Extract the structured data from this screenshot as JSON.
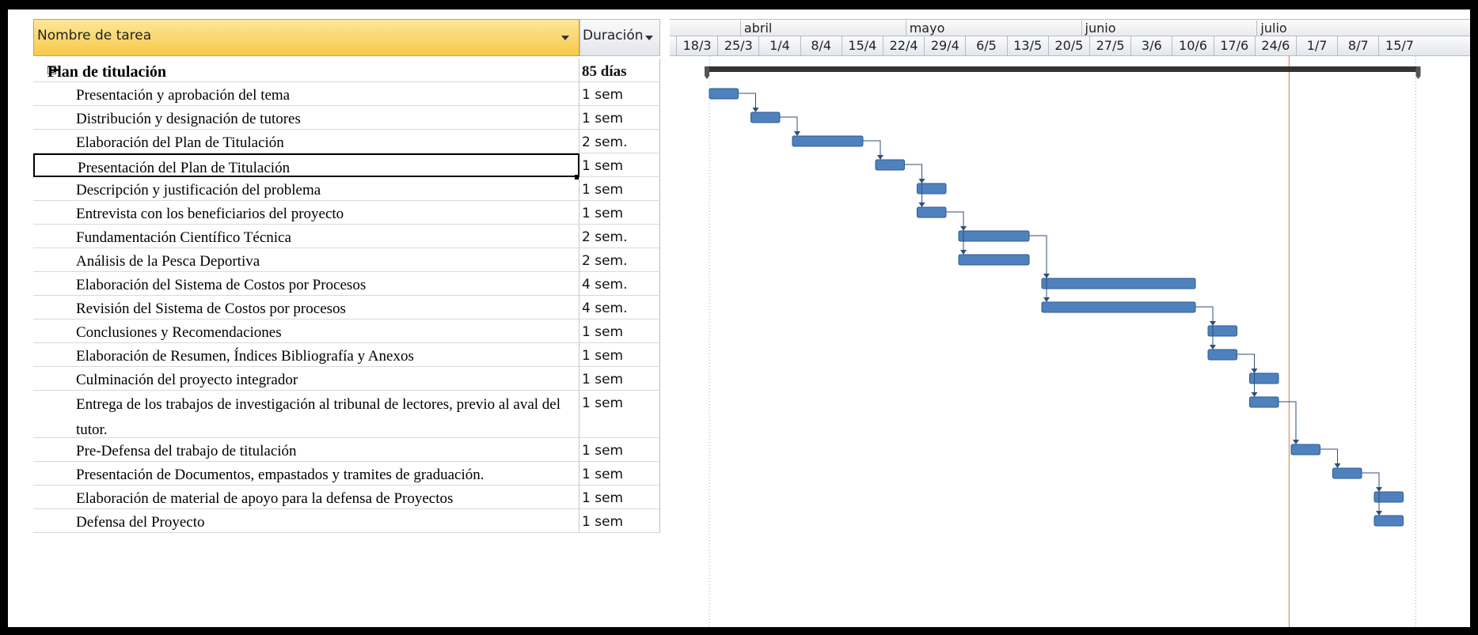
{
  "table": {
    "col_task": "Nombre de tarea",
    "col_duration": "Duración",
    "summary": {
      "name": "Plan de titulación",
      "duration": "85 días"
    },
    "rows": [
      {
        "name": "Presentación y aprobación del tema",
        "duration": "1 sem",
        "start": 0,
        "weeks": 1
      },
      {
        "name": "Distribución y designación de tutores",
        "duration": "1 sem",
        "start": 1,
        "weeks": 1
      },
      {
        "name": "Elaboración del Plan de Titulación",
        "duration": "2 sem.",
        "start": 2,
        "weeks": 2
      },
      {
        "name": "Presentación del Plan de Titulación",
        "duration": "1 sem",
        "start": 4,
        "weeks": 1
      },
      {
        "name": "Descripción y justificación del problema",
        "duration": "1 sem",
        "start": 5,
        "weeks": 1
      },
      {
        "name": "Entrevista con los beneficiarios del proyecto",
        "duration": "1 sem",
        "start": 5,
        "weeks": 1
      },
      {
        "name": "Fundamentación Científico Técnica",
        "duration": "2 sem.",
        "start": 6,
        "weeks": 2
      },
      {
        "name": "Análisis de la Pesca Deportiva",
        "duration": "2 sem.",
        "start": 6,
        "weeks": 2
      },
      {
        "name": "Elaboración del Sistema de Costos por Procesos",
        "duration": "4 sem.",
        "start": 8,
        "weeks": 4
      },
      {
        "name": "Revisión del Sistema de Costos por procesos",
        "duration": "4 sem.",
        "start": 8,
        "weeks": 4
      },
      {
        "name": "Conclusiones y Recomendaciones",
        "duration": "1 sem",
        "start": 12,
        "weeks": 1
      },
      {
        "name": "Elaboración de Resumen, Índices Bibliografía y Anexos",
        "duration": "1 sem",
        "start": 12,
        "weeks": 1
      },
      {
        "name": "Culminación del proyecto integrador",
        "duration": "1 sem",
        "start": 13,
        "weeks": 1
      },
      {
        "name": "Entrega de los trabajos de investigación al tribunal de lectores, previo al aval del tutor.",
        "duration": "1 sem",
        "start": 13,
        "weeks": 1
      },
      {
        "name": "Pre-Defensa del trabajo de titulación",
        "duration": "1 sem",
        "start": 14,
        "weeks": 1
      },
      {
        "name": "Presentación de Documentos, empastados y tramites de graduación.",
        "duration": "1 sem",
        "start": 15,
        "weeks": 1
      },
      {
        "name": "Elaboración de material de apoyo para la defensa de Proyectos",
        "duration": "1 sem",
        "start": 16,
        "weeks": 1
      },
      {
        "name": "Defensa del Proyecto",
        "duration": "1 sem",
        "start": 16,
        "weeks": 1
      }
    ]
  },
  "timeline": {
    "months": [
      "abril",
      "mayo",
      "junio",
      "julio"
    ],
    "weeks": [
      "18/3",
      "25/3",
      "1/4",
      "8/4",
      "15/4",
      "22/4",
      "29/4",
      "6/5",
      "13/5",
      "20/5",
      "27/5",
      "3/6",
      "10/6",
      "17/6",
      "24/6",
      "1/7",
      "8/7",
      "15/7"
    ]
  },
  "colors": {
    "bar": "#4f81bd",
    "bar_dark": "#2b5a95",
    "today_line": "#e07b39",
    "link": "#2d4f7c"
  }
}
